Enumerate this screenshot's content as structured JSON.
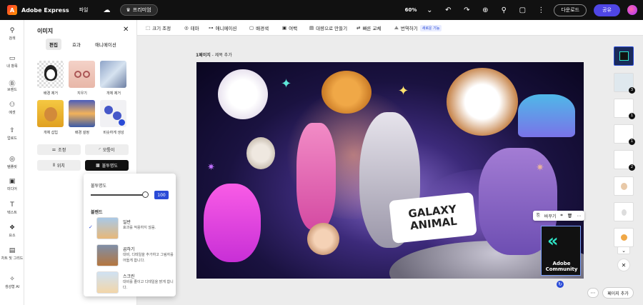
{
  "topbar": {
    "brand": "Adobe Express",
    "file_menu": "파일",
    "premium": "프리미엄",
    "zoom": "60%",
    "download": "다운로드",
    "share": "공유"
  },
  "rail": [
    {
      "icon": "search-icon",
      "glyph": "⚲",
      "label": "검색"
    },
    {
      "icon": "folder-icon",
      "glyph": "▭",
      "label": "내 항목"
    },
    {
      "icon": "brand-icon",
      "glyph": "Ⓑ",
      "label": "브랜드"
    },
    {
      "icon": "template-icon",
      "glyph": "⚇",
      "label": "에셋"
    },
    {
      "icon": "upload-icon",
      "glyph": "⇧",
      "label": "업로드"
    },
    {
      "icon": "template-grid-icon",
      "glyph": "◎",
      "label": "템플릿"
    },
    {
      "icon": "media-icon",
      "glyph": "▣",
      "label": "미디어"
    },
    {
      "icon": "text-icon",
      "glyph": "T",
      "label": "텍스트"
    },
    {
      "icon": "elements-icon",
      "glyph": "❖",
      "label": "요소"
    },
    {
      "icon": "charts-icon",
      "glyph": "▤",
      "label": "차트 및 그리드"
    },
    {
      "icon": "ai-icon",
      "glyph": "✧",
      "label": "생성형 AI"
    }
  ],
  "panel": {
    "title": "이미지",
    "tabs": [
      "편집",
      "효과",
      "애니메이션"
    ],
    "thumbs": [
      "배경 제거",
      "지우기",
      "개체 제거",
      "개체 삽입",
      "배경 설정",
      "비슷하게 생성"
    ],
    "btn_adjust": "조정",
    "btn_corner": "모퉁이",
    "btn_position": "위치",
    "btn_opacity": "불투명도"
  },
  "popup": {
    "opacity_label": "불투명도",
    "opacity_value": "100",
    "opacity_level": 1.0,
    "blend_label": "블렌드",
    "blends": [
      {
        "name": "일반",
        "desc": "효과를 적용하지 않음."
      },
      {
        "name": "곱하기",
        "desc": "대비, 디테일을 추가하고 그림자를 어둡게 합니다."
      },
      {
        "name": "스크린",
        "desc": "대비를 줄이고 디테일을 밝게 합니다."
      }
    ]
  },
  "toolbar": {
    "resize": "크기 조정",
    "theme": "테마",
    "animation": "애니메이션",
    "background": "배경색",
    "margin": "여백",
    "video": "대량으로 만들기",
    "quick_swap": "빠른 교체",
    "translate": "번역하기",
    "new_badge": "새로운 기능"
  },
  "page": {
    "label_bold": "1페이지",
    "label_rest": " - 제목 추가"
  },
  "canvas": {
    "sticker_line1": "GALAXY",
    "sticker_line2": "ANIMAL",
    "tile_text1": "Adobe",
    "tile_text2": "Community",
    "sel_replace": "바꾸기"
  },
  "pages_panel": {
    "badges": [
      "3",
      "1",
      "1",
      "2"
    ],
    "add_page": "페이지 추가"
  },
  "colors": {
    "accent": "#4f46e5",
    "selection": "#2a4bd7"
  }
}
